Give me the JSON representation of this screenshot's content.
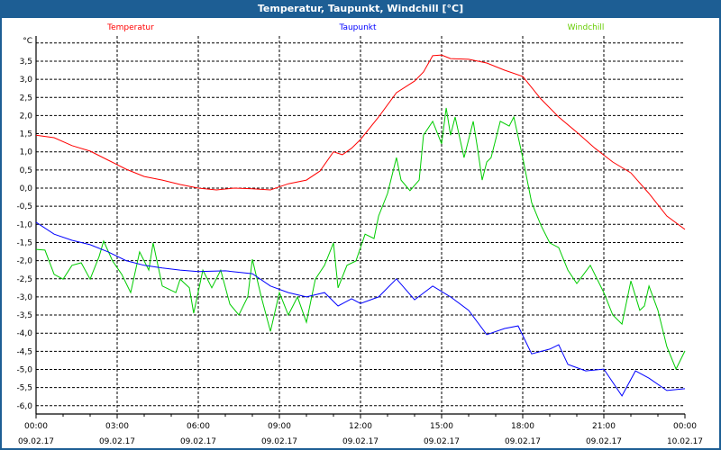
{
  "window": {
    "title": "Temperatur, Taupunkt, Windchill [°C]"
  },
  "chart_data": {
    "type": "line",
    "title": "Temperatur, Taupunkt, Windchill [°C]",
    "ylabel": "°C",
    "ylim": [
      -6.25,
      4.25
    ],
    "xlim_hours": [
      0,
      24
    ],
    "grid": true,
    "legend_placement": "top",
    "y_ticks": [
      3.5,
      3.0,
      2.5,
      2.0,
      1.5,
      1.0,
      0.5,
      0.0,
      -0.5,
      -1.0,
      -1.5,
      -2.0,
      -2.5,
      -3.0,
      -3.5,
      -4.0,
      -4.5,
      -5.0,
      -5.5,
      -6.0
    ],
    "y_tick_labels": [
      "3,5",
      "3,0",
      "2,5",
      "2,0",
      "1,5",
      "1,0",
      "0,5",
      "0,0",
      "-0,5",
      "-1,0",
      "-1,5",
      "-2,0",
      "-2,5",
      "-3,0",
      "-3,5",
      "-4,0",
      "-4,5",
      "-5,0",
      "-5,5",
      "-6,0"
    ],
    "grid_y": [
      4.0,
      3.5,
      3.0,
      2.5,
      2.0,
      1.5,
      1.0,
      0.5,
      0.0,
      -0.5,
      -1.0,
      -1.5,
      -2.0,
      -2.5,
      -3.0,
      -3.5,
      -4.0,
      -4.5,
      -5.0,
      -5.5,
      -6.0
    ],
    "x_ticks": [
      {
        "hour": 0,
        "time": "00:00",
        "date": "09.02.17"
      },
      {
        "hour": 3,
        "time": "03:00",
        "date": "09.02.17"
      },
      {
        "hour": 6,
        "time": "06:00",
        "date": "09.02.17"
      },
      {
        "hour": 9,
        "time": "09:00",
        "date": "09.02.17"
      },
      {
        "hour": 12,
        "time": "12:00",
        "date": "09.02.17"
      },
      {
        "hour": 15,
        "time": "15:00",
        "date": "09.02.17"
      },
      {
        "hour": 18,
        "time": "18:00",
        "date": "09.02.17"
      },
      {
        "hour": 21,
        "time": "21:00",
        "date": "09.02.17"
      },
      {
        "hour": 24,
        "time": "00:00",
        "date": "10.02.17"
      }
    ],
    "series": [
      {
        "name": "Temperatur",
        "color": "#ff0000",
        "points": [
          [
            0,
            1.46
          ],
          [
            0.67,
            1.39
          ],
          [
            1.33,
            1.17
          ],
          [
            2,
            1.02
          ],
          [
            2.67,
            0.77
          ],
          [
            3.33,
            0.52
          ],
          [
            4,
            0.32
          ],
          [
            4.67,
            0.22
          ],
          [
            5.33,
            0.1
          ],
          [
            6,
            0
          ],
          [
            6.67,
            -0.05
          ],
          [
            7.33,
            0
          ],
          [
            8,
            -0.02
          ],
          [
            8.67,
            -0.05
          ],
          [
            9.33,
            0.12
          ],
          [
            10,
            0.22
          ],
          [
            10.5,
            0.47
          ],
          [
            11,
            1.0
          ],
          [
            11.33,
            0.92
          ],
          [
            11.67,
            1.1
          ],
          [
            12,
            1.34
          ],
          [
            12.67,
            1.96
          ],
          [
            13.33,
            2.63
          ],
          [
            14,
            2.95
          ],
          [
            14.33,
            3.2
          ],
          [
            14.67,
            3.65
          ],
          [
            15,
            3.67
          ],
          [
            15.33,
            3.57
          ],
          [
            16,
            3.55
          ],
          [
            16.67,
            3.45
          ],
          [
            17.33,
            3.25
          ],
          [
            18,
            3.08
          ],
          [
            18.67,
            2.46
          ],
          [
            19.33,
            1.96
          ],
          [
            20,
            1.54
          ],
          [
            20.67,
            1.1
          ],
          [
            21.33,
            0.72
          ],
          [
            22,
            0.42
          ],
          [
            22.67,
            -0.15
          ],
          [
            23.33,
            -0.77
          ],
          [
            24,
            -1.14
          ]
        ]
      },
      {
        "name": "Taupunkt",
        "color": "#0000ff",
        "points": [
          [
            0,
            -0.94
          ],
          [
            0.67,
            -1.27
          ],
          [
            1.33,
            -1.44
          ],
          [
            2,
            -1.56
          ],
          [
            2.67,
            -1.76
          ],
          [
            3.33,
            -2.0
          ],
          [
            4,
            -2.13
          ],
          [
            4.67,
            -2.2
          ],
          [
            5.33,
            -2.26
          ],
          [
            6,
            -2.3
          ],
          [
            7,
            -2.28
          ],
          [
            8,
            -2.36
          ],
          [
            8.67,
            -2.7
          ],
          [
            9.33,
            -2.88
          ],
          [
            10,
            -3.0
          ],
          [
            10.67,
            -2.88
          ],
          [
            11.17,
            -3.25
          ],
          [
            11.67,
            -3.05
          ],
          [
            12,
            -3.18
          ],
          [
            12.67,
            -3.0
          ],
          [
            13.33,
            -2.5
          ],
          [
            14,
            -3.08
          ],
          [
            14.67,
            -2.7
          ],
          [
            15.33,
            -3.0
          ],
          [
            16,
            -3.37
          ],
          [
            16.67,
            -4.04
          ],
          [
            17.33,
            -3.87
          ],
          [
            17.83,
            -3.8
          ],
          [
            18.33,
            -4.57
          ],
          [
            19,
            -4.44
          ],
          [
            19.33,
            -4.32
          ],
          [
            19.67,
            -4.86
          ],
          [
            20.33,
            -5.04
          ],
          [
            21,
            -4.99
          ],
          [
            21.67,
            -5.73
          ],
          [
            22.17,
            -5.04
          ],
          [
            22.67,
            -5.24
          ],
          [
            23.33,
            -5.58
          ],
          [
            24,
            -5.53
          ]
        ]
      },
      {
        "name": "Windchill",
        "color": "#00cc00",
        "legend_color": "#66cc00",
        "points": [
          [
            0,
            -1.69
          ],
          [
            0.33,
            -1.71
          ],
          [
            0.67,
            -2.38
          ],
          [
            1,
            -2.51
          ],
          [
            1.33,
            -2.13
          ],
          [
            1.67,
            -2.06
          ],
          [
            2,
            -2.51
          ],
          [
            2.33,
            -1.89
          ],
          [
            2.5,
            -1.46
          ],
          [
            2.83,
            -2.01
          ],
          [
            3.17,
            -2.38
          ],
          [
            3.5,
            -2.88
          ],
          [
            3.83,
            -1.76
          ],
          [
            4.17,
            -2.26
          ],
          [
            4.33,
            -1.51
          ],
          [
            4.67,
            -2.7
          ],
          [
            5.17,
            -2.88
          ],
          [
            5.33,
            -2.51
          ],
          [
            5.67,
            -2.75
          ],
          [
            5.83,
            -3.45
          ],
          [
            6.17,
            -2.26
          ],
          [
            6.5,
            -2.75
          ],
          [
            6.83,
            -2.26
          ],
          [
            7.17,
            -3.2
          ],
          [
            7.5,
            -3.5
          ],
          [
            7.83,
            -3.0
          ],
          [
            8,
            -1.96
          ],
          [
            8.33,
            -3.0
          ],
          [
            8.67,
            -3.95
          ],
          [
            9,
            -2.88
          ],
          [
            9.33,
            -3.5
          ],
          [
            9.67,
            -3.0
          ],
          [
            10,
            -3.7
          ],
          [
            10.33,
            -2.51
          ],
          [
            10.67,
            -2.13
          ],
          [
            11,
            -1.51
          ],
          [
            11.17,
            -2.75
          ],
          [
            11.5,
            -2.13
          ],
          [
            11.83,
            -2.01
          ],
          [
            12.17,
            -1.27
          ],
          [
            12.5,
            -1.39
          ],
          [
            12.67,
            -0.77
          ],
          [
            13,
            -0.15
          ],
          [
            13.33,
            0.84
          ],
          [
            13.5,
            0.22
          ],
          [
            13.83,
            -0.07
          ],
          [
            14.17,
            0.22
          ],
          [
            14.33,
            1.46
          ],
          [
            14.67,
            1.84
          ],
          [
            15,
            1.22
          ],
          [
            15.17,
            2.21
          ],
          [
            15.33,
            1.46
          ],
          [
            15.5,
            1.96
          ],
          [
            15.83,
            0.84
          ],
          [
            16.17,
            1.84
          ],
          [
            16.33,
            1.09
          ],
          [
            16.5,
            0.22
          ],
          [
            16.67,
            0.72
          ],
          [
            16.83,
            0.84
          ],
          [
            17.17,
            1.84
          ],
          [
            17.5,
            1.71
          ],
          [
            17.67,
            1.96
          ],
          [
            18,
            0.84
          ],
          [
            18.33,
            -0.4
          ],
          [
            18.67,
            -1.02
          ],
          [
            19,
            -1.51
          ],
          [
            19.33,
            -1.64
          ],
          [
            19.67,
            -2.26
          ],
          [
            20,
            -2.63
          ],
          [
            20.5,
            -2.13
          ],
          [
            21,
            -2.88
          ],
          [
            21.33,
            -3.5
          ],
          [
            21.67,
            -3.75
          ],
          [
            22,
            -2.56
          ],
          [
            22.33,
            -3.37
          ],
          [
            22.5,
            -3.25
          ],
          [
            22.67,
            -2.7
          ],
          [
            23,
            -3.37
          ],
          [
            23.33,
            -4.37
          ],
          [
            23.67,
            -4.99
          ],
          [
            24,
            -4.49
          ]
        ]
      }
    ]
  }
}
